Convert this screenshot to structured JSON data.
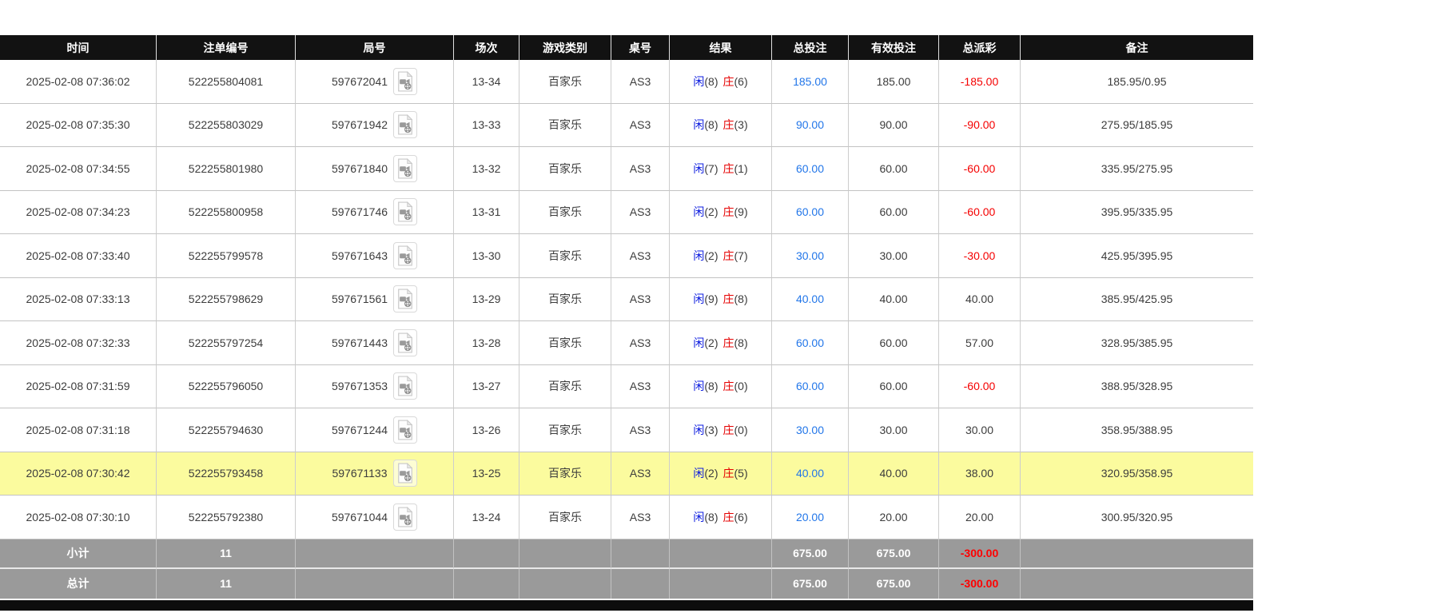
{
  "table": {
    "headers": [
      "时间",
      "注单编号",
      "局号",
      "场次",
      "游戏类别",
      "桌号",
      "结果",
      "总投注",
      "有效投注",
      "总派彩",
      "备注"
    ],
    "labels": {
      "player": "闲",
      "banker": "庄"
    },
    "icons": {
      "round_video": "video-replay-icon"
    },
    "rows": [
      {
        "time": "2025-02-08 07:36:02",
        "bet_id": "522255804081",
        "round": "597672041",
        "session": "13-34",
        "game": "百家乐",
        "table_no": "AS3",
        "player_score": "(8)",
        "banker_score": "(6)",
        "total_bet": "185.00",
        "valid_bet": "185.00",
        "payout": "-185.00",
        "remark": "185.95/0.95",
        "highlight": false
      },
      {
        "time": "2025-02-08 07:35:30",
        "bet_id": "522255803029",
        "round": "597671942",
        "session": "13-33",
        "game": "百家乐",
        "table_no": "AS3",
        "player_score": "(8)",
        "banker_score": "(3)",
        "total_bet": "90.00",
        "valid_bet": "90.00",
        "payout": "-90.00",
        "remark": "275.95/185.95",
        "highlight": false
      },
      {
        "time": "2025-02-08 07:34:55",
        "bet_id": "522255801980",
        "round": "597671840",
        "session": "13-32",
        "game": "百家乐",
        "table_no": "AS3",
        "player_score": "(7)",
        "banker_score": "(1)",
        "total_bet": "60.00",
        "valid_bet": "60.00",
        "payout": "-60.00",
        "remark": "335.95/275.95",
        "highlight": false
      },
      {
        "time": "2025-02-08 07:34:23",
        "bet_id": "522255800958",
        "round": "597671746",
        "session": "13-31",
        "game": "百家乐",
        "table_no": "AS3",
        "player_score": "(2)",
        "banker_score": "(9)",
        "total_bet": "60.00",
        "valid_bet": "60.00",
        "payout": "-60.00",
        "remark": "395.95/335.95",
        "highlight": false
      },
      {
        "time": "2025-02-08 07:33:40",
        "bet_id": "522255799578",
        "round": "597671643",
        "session": "13-30",
        "game": "百家乐",
        "table_no": "AS3",
        "player_score": "(2)",
        "banker_score": "(7)",
        "total_bet": "30.00",
        "valid_bet": "30.00",
        "payout": "-30.00",
        "remark": "425.95/395.95",
        "highlight": false
      },
      {
        "time": "2025-02-08 07:33:13",
        "bet_id": "522255798629",
        "round": "597671561",
        "session": "13-29",
        "game": "百家乐",
        "table_no": "AS3",
        "player_score": "(9)",
        "banker_score": "(8)",
        "total_bet": "40.00",
        "valid_bet": "40.00",
        "payout": "40.00",
        "remark": "385.95/425.95",
        "highlight": false
      },
      {
        "time": "2025-02-08 07:32:33",
        "bet_id": "522255797254",
        "round": "597671443",
        "session": "13-28",
        "game": "百家乐",
        "table_no": "AS3",
        "player_score": "(2)",
        "banker_score": "(8)",
        "total_bet": "60.00",
        "valid_bet": "60.00",
        "payout": "57.00",
        "remark": "328.95/385.95",
        "highlight": false
      },
      {
        "time": "2025-02-08 07:31:59",
        "bet_id": "522255796050",
        "round": "597671353",
        "session": "13-27",
        "game": "百家乐",
        "table_no": "AS3",
        "player_score": "(8)",
        "banker_score": "(0)",
        "total_bet": "60.00",
        "valid_bet": "60.00",
        "payout": "-60.00",
        "remark": "388.95/328.95",
        "highlight": false
      },
      {
        "time": "2025-02-08 07:31:18",
        "bet_id": "522255794630",
        "round": "597671244",
        "session": "13-26",
        "game": "百家乐",
        "table_no": "AS3",
        "player_score": "(3)",
        "banker_score": "(0)",
        "total_bet": "30.00",
        "valid_bet": "30.00",
        "payout": "30.00",
        "remark": "358.95/388.95",
        "highlight": false
      },
      {
        "time": "2025-02-08 07:30:42",
        "bet_id": "522255793458",
        "round": "597671133",
        "session": "13-25",
        "game": "百家乐",
        "table_no": "AS3",
        "player_score": "(2)",
        "banker_score": "(5)",
        "total_bet": "40.00",
        "valid_bet": "40.00",
        "payout": "38.00",
        "remark": "320.95/358.95",
        "highlight": true
      },
      {
        "time": "2025-02-08 07:30:10",
        "bet_id": "522255792380",
        "round": "597671044",
        "session": "13-24",
        "game": "百家乐",
        "table_no": "AS3",
        "player_score": "(8)",
        "banker_score": "(6)",
        "total_bet": "20.00",
        "valid_bet": "20.00",
        "payout": "20.00",
        "remark": "300.95/320.95",
        "highlight": false
      }
    ],
    "subtotal": {
      "label": "小计",
      "count": "11",
      "total_bet": "675.00",
      "valid_bet": "675.00",
      "payout": "-300.00"
    },
    "total": {
      "label": "总计",
      "count": "11",
      "total_bet": "675.00",
      "valid_bet": "675.00",
      "payout": "-300.00"
    }
  },
  "colors": {
    "header_bg": "#121212",
    "header_text": "#ffffff",
    "row_text": "#3c3c3c",
    "player_blue": "#0b1bdf",
    "banker_red": "#e50000",
    "bet_amount_blue": "#2276e9",
    "negative_red": "#f50000",
    "highlight_yellow": "#fbfb9e",
    "summary_bg": "#9a9a9a",
    "footer_bar": "#0d0d0d"
  }
}
